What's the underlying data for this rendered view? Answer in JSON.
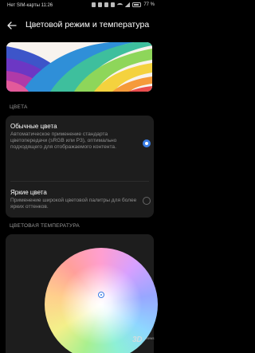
{
  "status_bar": {
    "carrier_time": "Нет SIM-карты 11:26",
    "battery_text": "77 %",
    "battery_level": 0.77
  },
  "header": {
    "title": "Цветовой режим и температура",
    "back_icon": "arrow-left-icon"
  },
  "colors_section": {
    "label": "ЦВЕТА",
    "options": [
      {
        "title": "Обычные цвета",
        "description": "Автоматическое применение стандарта цветопередачи (sRGB или P3), оптимально подходящего для отображаемого контента.",
        "selected": true
      },
      {
        "title": "Яркие цвета",
        "description": "Применение широкой цветовой палитры для более ярких оттенков.",
        "selected": false
      }
    ]
  },
  "temperature_section": {
    "label": "ЦВЕТОВАЯ ТЕМПЕРАТУРА"
  },
  "watermark": {
    "brand": "3D",
    "sub": "news"
  },
  "colors": {
    "accent": "#3a7de4",
    "background": "#000000",
    "card": "#1d1d1d"
  }
}
